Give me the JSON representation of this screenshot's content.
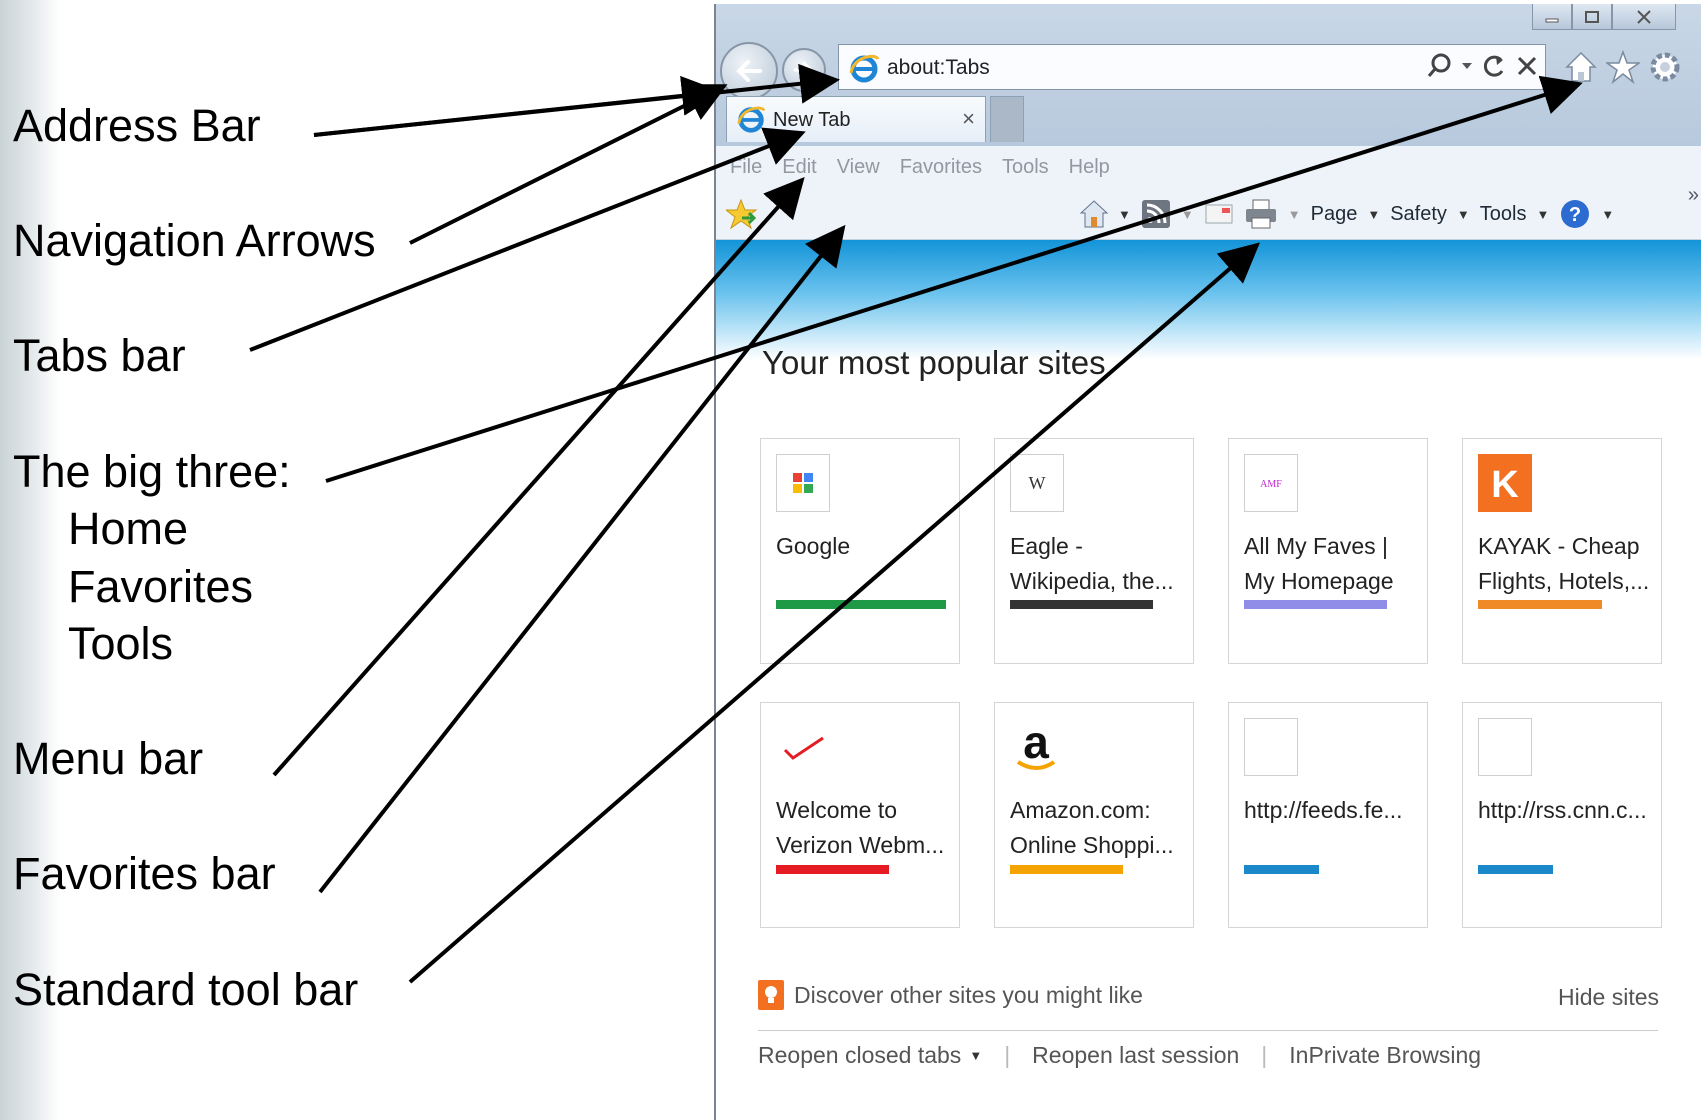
{
  "annotations": {
    "address_bar": "Address Bar",
    "navigation_arrows": "Navigation Arrows",
    "tabs_bar": "Tabs bar",
    "big_three": "The big three:",
    "home": "Home",
    "favorites": "Favorites",
    "tools": "Tools",
    "menu_bar": "Menu bar",
    "favorites_bar": "Favorites bar",
    "standard_tool_bar": "Standard tool bar"
  },
  "browser": {
    "address": "about:Tabs",
    "tab_label": "New Tab",
    "tab_close": "×",
    "menu": [
      "File",
      "Edit",
      "View",
      "Favorites",
      "Tools",
      "Help"
    ],
    "command_bar": {
      "page": "Page",
      "safety": "Safety",
      "tools": "Tools",
      "overflow": "»"
    },
    "heading": "Your most popular sites",
    "tiles": [
      {
        "title": "Google",
        "color": "#1e9a47"
      },
      {
        "title": "Eagle - Wikipedia, the...",
        "color": "#333333"
      },
      {
        "title": "All My Faves | My Homepage",
        "color": "#8f8de8"
      },
      {
        "title": "KAYAK - Cheap Flights, Hotels,...",
        "color": "#f08a26"
      },
      {
        "title": "Welcome to Verizon Webm...",
        "color": "#e51c23"
      },
      {
        "title": "Amazon.com: Online Shoppi...",
        "color": "#f5a300"
      },
      {
        "title": "http://feeds.fe...",
        "color": "#1a88c9"
      },
      {
        "title": "http://rss.cnn.c...",
        "color": "#1a88c9"
      }
    ],
    "discover": "Discover other sites you might like",
    "hide_sites": "Hide sites",
    "reopen_closed": "Reopen closed tabs",
    "reopen_last": "Reopen last session",
    "inprivate": "InPrivate Browsing",
    "separator": "|"
  }
}
